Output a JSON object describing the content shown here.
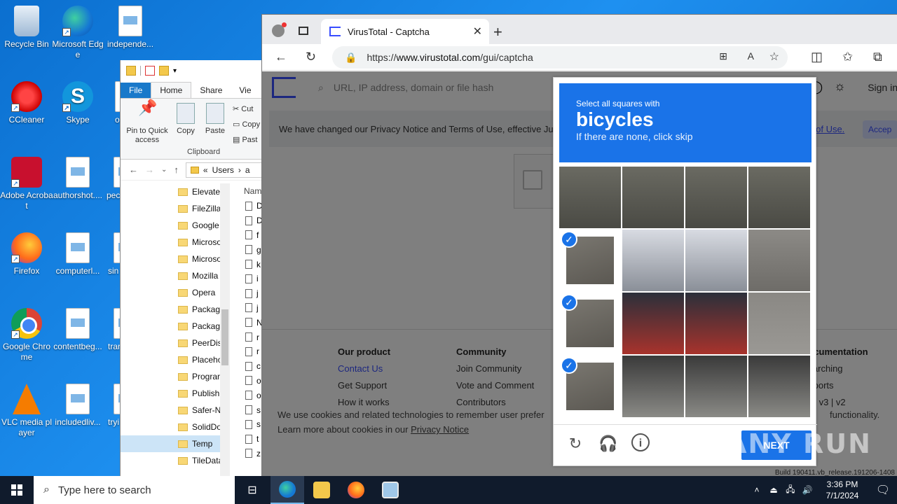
{
  "desktop": {
    "icons": [
      {
        "label": "Recycle Bin"
      },
      {
        "label": "Microsoft Edge"
      },
      {
        "label": "independe..."
      },
      {
        "label": "CCleaner"
      },
      {
        "label": "Skype"
      },
      {
        "label": "Adobe Acrobat"
      },
      {
        "label": "authorshot...."
      },
      {
        "label": "Firefox"
      },
      {
        "label": "computerl..."
      },
      {
        "label": "Google Chrome"
      },
      {
        "label": "contentbeg..."
      },
      {
        "label": "VLC media player"
      },
      {
        "label": "includedliv..."
      }
    ],
    "partial_labels": [
      "o",
      "pec",
      "sin",
      "trar",
      "tryi"
    ]
  },
  "explorer": {
    "tabs": {
      "file": "File",
      "home": "Home",
      "share": "Share",
      "view": "Vie"
    },
    "ribbon": {
      "pin": "Pin to Quick access",
      "copy": "Copy",
      "paste": "Paste",
      "cut": "Cut",
      "copy_path": "Copy",
      "paste_shortcut": "Past",
      "clipboard": "Clipboard"
    },
    "address": {
      "prefix": "«",
      "users": "Users",
      "next": "a"
    },
    "nav_items": [
      "Elevate",
      "FileZilla",
      "Google",
      "Microso",
      "Microso",
      "Mozilla",
      "Opera",
      "Packag",
      "Packag",
      "PeerDis",
      "Placeho",
      "Prograr",
      "Publish",
      "Safer-N",
      "SolidDo",
      "Temp",
      "TileData"
    ],
    "selected_item": "Temp",
    "column_header": "Nam",
    "file_letters": [
      "D",
      "D",
      "f",
      "g",
      "k",
      "i",
      "j",
      "j",
      "N",
      "r",
      "r",
      "c",
      "o",
      "o",
      "s",
      "s",
      "t",
      "z"
    ]
  },
  "browser": {
    "tab_title": "VirusTotal - Captcha",
    "url_prefix": "https://",
    "url_host": "www.virustotal.com",
    "url_path": "/gui/captcha",
    "search_placeholder": "URL, IP address, domain or file hash",
    "sign_in": "Sign in",
    "privacy_notice": "We have changed our Privacy Notice and Terms of Use, effective Ju",
    "terms_link": "s of Use.",
    "accept": "Accep",
    "footer": {
      "our_product": {
        "heading": "Our product",
        "links": [
          "Contact Us",
          "Get Support",
          "How it works"
        ]
      },
      "community": {
        "heading": "Community",
        "links": [
          "Join Community",
          "Vote and Comment",
          "Contributors"
        ]
      },
      "documentation": {
        "heading": "Documentation",
        "links": [
          "Searching",
          "Reports",
          "API v3 | v2"
        ]
      }
    },
    "cookie_line1": "We use cookies and related technologies to remember user prefer",
    "cookie_line1_end": "functionality.",
    "cookie_line2": "Learn more about cookies in our ",
    "cookie_link": "Privacy Notice",
    "build": "Build 190411.vb_release.191206-1408"
  },
  "captcha": {
    "instruction": "Select all squares with",
    "target": "bicycles",
    "subtext": "If there are none, click skip",
    "next_label": "NEXT",
    "selected_tiles": [
      4,
      8,
      12
    ]
  },
  "watermark": "ANY RUN",
  "taskbar": {
    "search_placeholder": "Type here to search",
    "time": "3:36 PM",
    "date": "7/1/2024"
  },
  "colors": {
    "captcha_blue": "#1a73e8",
    "virustotal_blue": "#394eff",
    "taskbar": "#101b2c"
  }
}
